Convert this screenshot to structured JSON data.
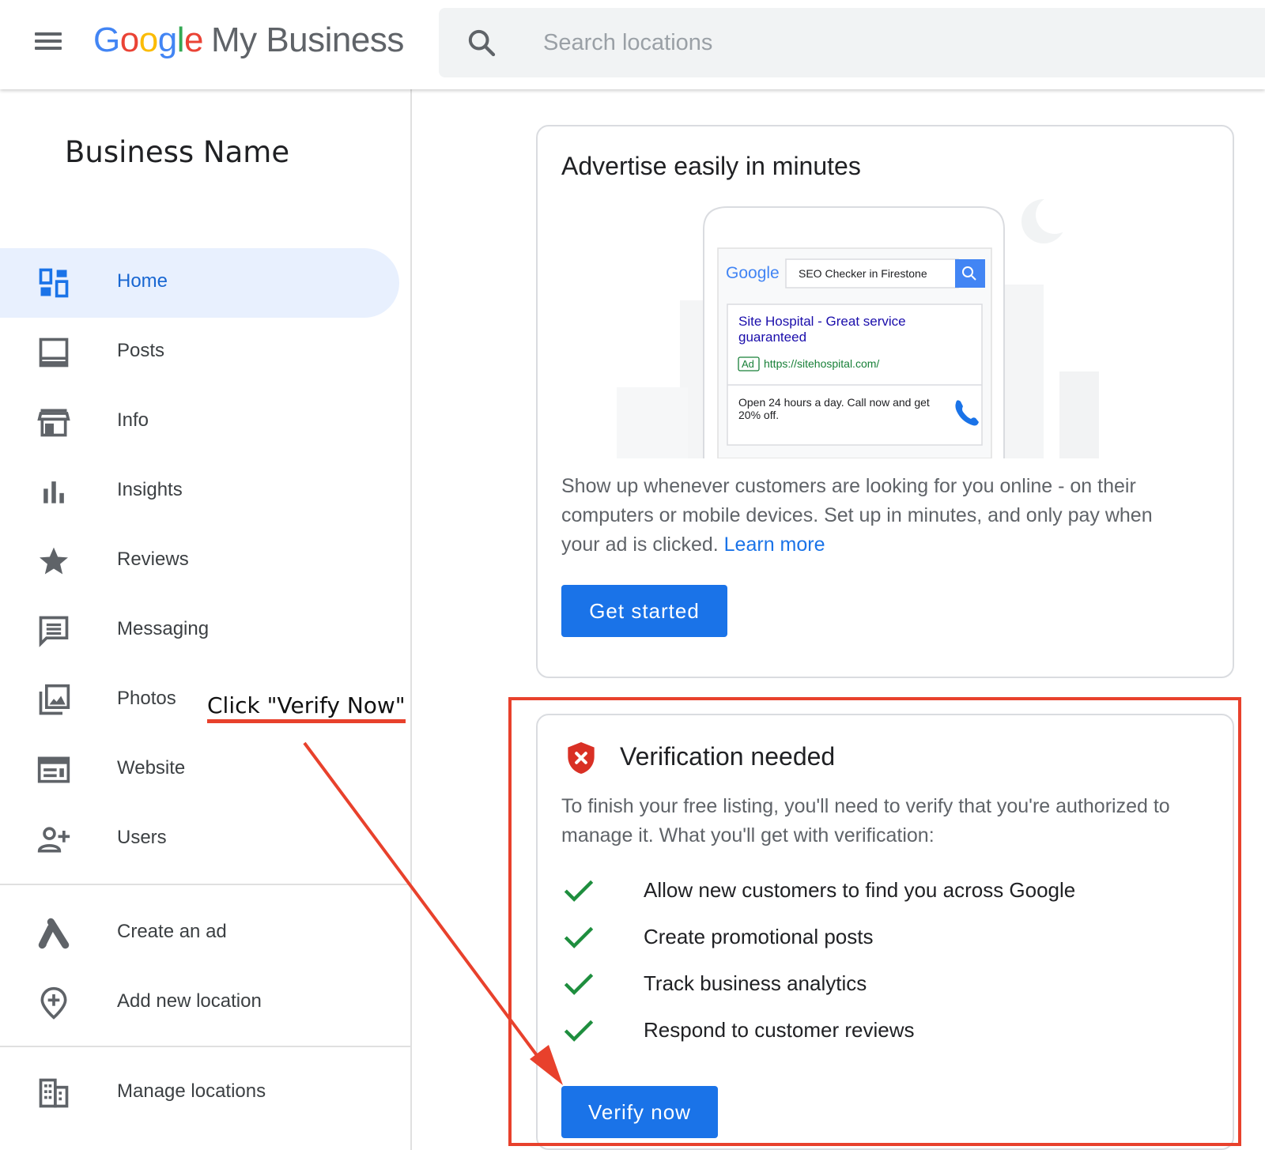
{
  "header": {
    "logo_google": [
      "G",
      "o",
      "o",
      "g",
      "l",
      "e"
    ],
    "logo_product": "My Business",
    "search_placeholder": "Search locations",
    "icons": {
      "menu": "hamburger-menu-icon",
      "search": "search-icon"
    }
  },
  "sidebar": {
    "business_name": "Business Name",
    "items": [
      {
        "label": "Home",
        "icon": "dashboard-icon",
        "active": true
      },
      {
        "label": "Posts",
        "icon": "posts-icon"
      },
      {
        "label": "Info",
        "icon": "storefront-icon"
      },
      {
        "label": "Insights",
        "icon": "bar-chart-icon"
      },
      {
        "label": "Reviews",
        "icon": "star-icon"
      },
      {
        "label": "Messaging",
        "icon": "message-icon"
      },
      {
        "label": "Photos",
        "icon": "photo-library-icon"
      },
      {
        "label": "Website",
        "icon": "web-icon"
      },
      {
        "label": "Users",
        "icon": "add-user-icon"
      },
      {
        "label": "Create an ad",
        "icon": "google-ads-icon"
      },
      {
        "label": "Add new location",
        "icon": "add-location-icon"
      },
      {
        "label": "Manage locations",
        "icon": "building-icon"
      }
    ]
  },
  "advertise_card": {
    "title": "Advertise easily in minutes",
    "illustration": {
      "google_word": "Google",
      "search_query": "SEO Checker in Firestone",
      "ad_title": "Site Hospital - Great service guaranteed",
      "ad_title_line1": "Site Hospital - Great service",
      "ad_title_line2": "guaranteed",
      "ad_badge": "Ad",
      "ad_url": "https://sitehospital.com/",
      "ad_desc_line1": "Open 24 hours a day. Call now and get",
      "ad_desc_line2": "20% off."
    },
    "body": "Show up whenever customers are looking for you online - on their computers or mobile devices. Set up in minutes, and only pay when your ad is clicked.",
    "learn_more": "Learn more",
    "cta": "Get started"
  },
  "verification_card": {
    "title": "Verification needed",
    "body": "To finish your free listing, you'll need to verify that you're authorized to manage it. What you'll get with verification:",
    "benefits": [
      "Allow new customers to find you across Google",
      "Create promotional posts",
      "Track business analytics",
      "Respond to customer reviews"
    ],
    "cta": "Verify now"
  },
  "annotation": {
    "text": "Click \"Verify Now\"",
    "color": "#e8412c"
  },
  "colors": {
    "accent": "#1a73e8",
    "active_bg": "#e8f0fe",
    "check_green": "#1e8e3e",
    "shield_red": "#d93025"
  }
}
